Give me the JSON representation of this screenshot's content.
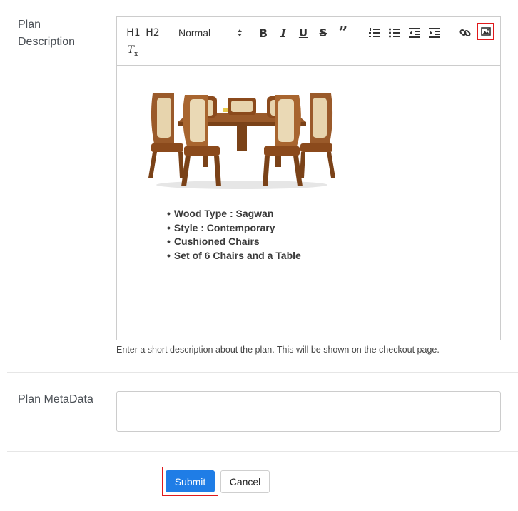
{
  "plan_description": {
    "label_line1": "Plan",
    "label_line2": "Description",
    "toolbar": {
      "h1": "H1",
      "h2": "H2",
      "format_select": "Normal",
      "icons": [
        "h1-icon",
        "h2-icon",
        "format-dropdown",
        "bold-icon",
        "italic-icon",
        "underline-icon",
        "strike-icon",
        "blockquote-icon",
        "ordered-list-icon",
        "bullet-list-icon",
        "outdent-icon",
        "indent-icon",
        "link-icon",
        "image-icon",
        "clear-format-icon"
      ],
      "highlight_color": "#e0191b"
    },
    "content": {
      "image": "dining-table-with-chairs",
      "bullets": [
        "Wood Type : Sagwan",
        "Style : Contemporary",
        "Cushioned Chairs",
        "Set of 6 Chairs and a Table"
      ]
    },
    "help_text": "Enter a short description about the plan. This will be shown on the checkout page."
  },
  "plan_metadata": {
    "label": "Plan MetaData",
    "value": ""
  },
  "actions": {
    "submit_label": "Submit",
    "cancel_label": "Cancel",
    "submit_color": "#1f7de6"
  }
}
